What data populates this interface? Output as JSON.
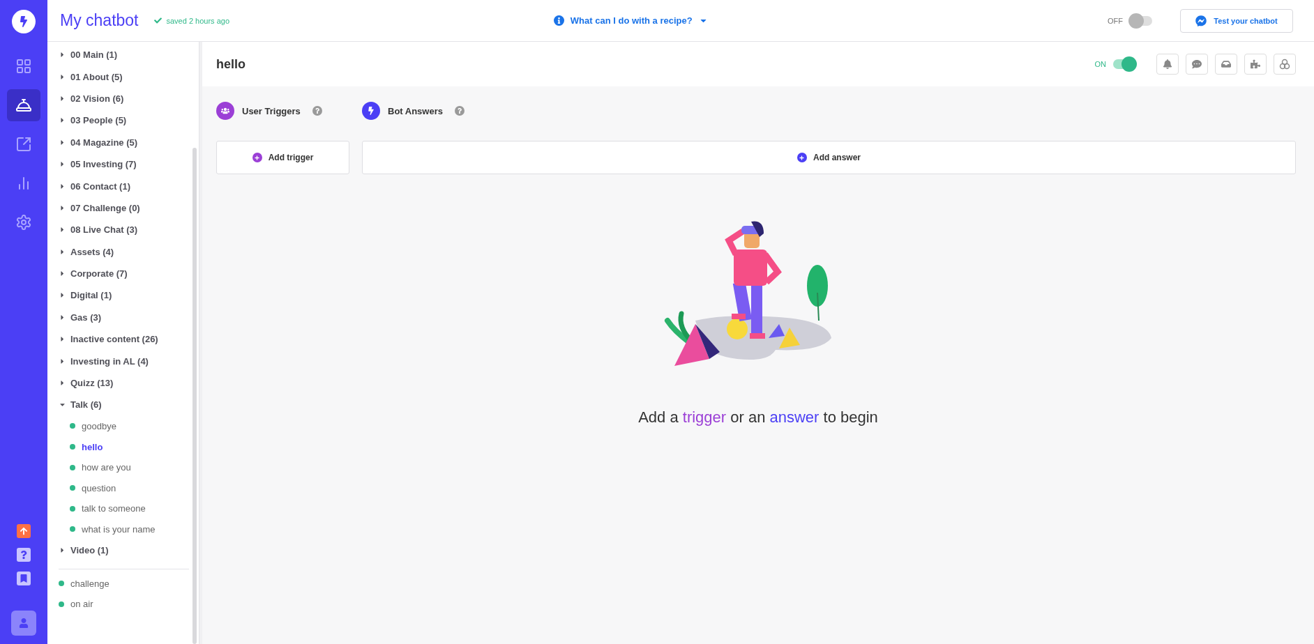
{
  "app": {
    "title": "My chatbot",
    "saved": "saved 2 hours ago"
  },
  "recipe": {
    "label": "What can I do with a recipe?"
  },
  "bot_toggle": {
    "label": "OFF",
    "on": false
  },
  "test_button": {
    "label": "Test your chatbot"
  },
  "rail": {
    "top": [
      {
        "selected": false
      },
      {
        "selected": true
      },
      {
        "selected": false
      },
      {
        "selected": false
      },
      {
        "selected": false
      }
    ],
    "bottom": [
      {
        "selected": false
      },
      {
        "selected": false
      },
      {
        "selected": false
      },
      {
        "selected": false
      }
    ]
  },
  "sidebar": {
    "groups": [
      {
        "label": "00 Main (1)",
        "expanded": false
      },
      {
        "label": "01 About (5)",
        "expanded": false
      },
      {
        "label": "02 Vision (6)",
        "expanded": false
      },
      {
        "label": "03 People (5)",
        "expanded": false
      },
      {
        "label": "04 Magazine (5)",
        "expanded": false
      },
      {
        "label": "05 Investing (7)",
        "expanded": false
      },
      {
        "label": "06 Contact (1)",
        "expanded": false
      },
      {
        "label": "07 Challenge (0)",
        "expanded": false
      },
      {
        "label": "08 Live Chat (3)",
        "expanded": false
      },
      {
        "label": "Assets (4)",
        "expanded": false
      },
      {
        "label": "Corporate (7)",
        "expanded": false
      },
      {
        "label": "Digital (1)",
        "expanded": false
      },
      {
        "label": "Gas (3)",
        "expanded": false
      },
      {
        "label": "Inactive content (26)",
        "expanded": false
      },
      {
        "label": "Investing in AL (4)",
        "expanded": false
      },
      {
        "label": "Quizz (13)",
        "expanded": false
      },
      {
        "label": "Talk (6)",
        "expanded": true,
        "children": [
          {
            "label": "goodbye",
            "selected": false
          },
          {
            "label": "hello",
            "selected": true
          },
          {
            "label": "how are you",
            "selected": false
          },
          {
            "label": "question",
            "selected": false
          },
          {
            "label": "talk to someone",
            "selected": false
          },
          {
            "label": "what is your name",
            "selected": false
          }
        ]
      },
      {
        "label": "Video (1)",
        "expanded": false
      }
    ],
    "extras": [
      {
        "label": "challenge",
        "selected": false
      },
      {
        "label": "on air",
        "selected": false
      }
    ]
  },
  "content": {
    "title": "hello",
    "toggle": {
      "label": "ON",
      "on": true
    },
    "sections": [
      {
        "kind": "trigger",
        "label": "User Triggers",
        "button": "Add trigger"
      },
      {
        "kind": "answer",
        "label": "Bot Answers",
        "button": "Add answer"
      }
    ],
    "empty_state": [
      {
        "kind": "plain",
        "text": "Add a "
      },
      {
        "kind": "trigger",
        "text": "trigger"
      },
      {
        "kind": "plain",
        "text": " or an "
      },
      {
        "kind": "answer",
        "text": "answer"
      },
      {
        "kind": "plain",
        "text": " to begin"
      }
    ]
  }
}
